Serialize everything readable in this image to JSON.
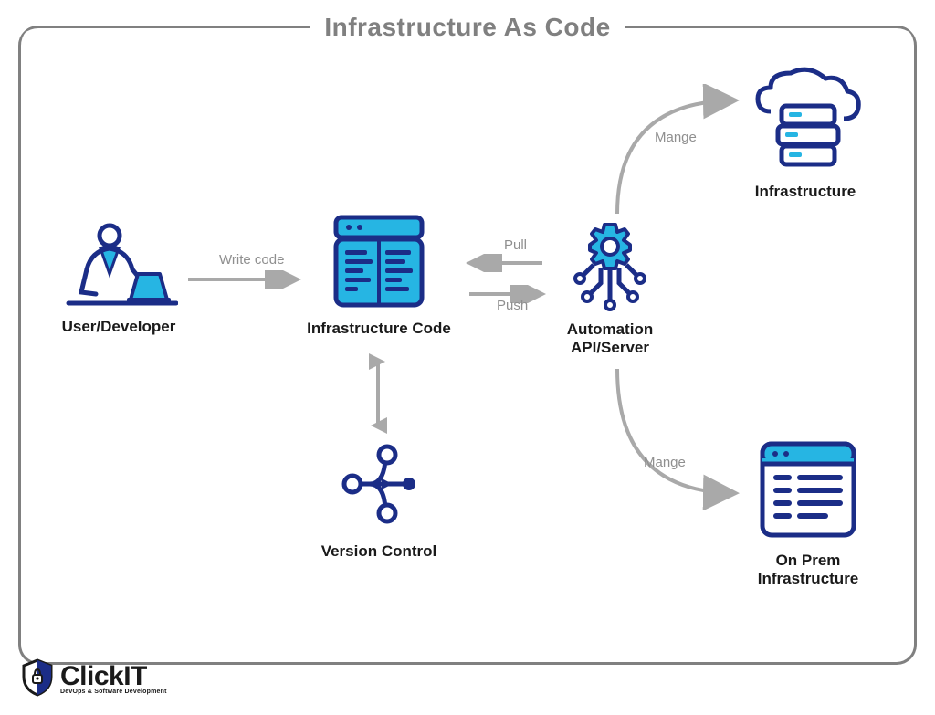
{
  "title": "Infrastructure As Code",
  "nodes": {
    "user": {
      "label": "User/Developer"
    },
    "infraCode": {
      "label": "Infrastructure Code"
    },
    "automation": {
      "label": "Automation\nAPI/Server"
    },
    "versionControl": {
      "label": "Version Control"
    },
    "cloudInfra": {
      "label": "Infrastructure"
    },
    "onPrem": {
      "label": "On Prem\nInfrastructure"
    }
  },
  "edges": {
    "writeCode": "Write code",
    "pull": "Pull",
    "push": "Push",
    "manageTop": "Mange",
    "manageBottom": "Mange"
  },
  "colors": {
    "navy": "#1b2d87",
    "cyan": "#26b5e3",
    "gray": "#a9a9a9",
    "frame": "#808080"
  },
  "brand": {
    "name": "ClickIT",
    "tagline": "DevOps & Software Development"
  }
}
